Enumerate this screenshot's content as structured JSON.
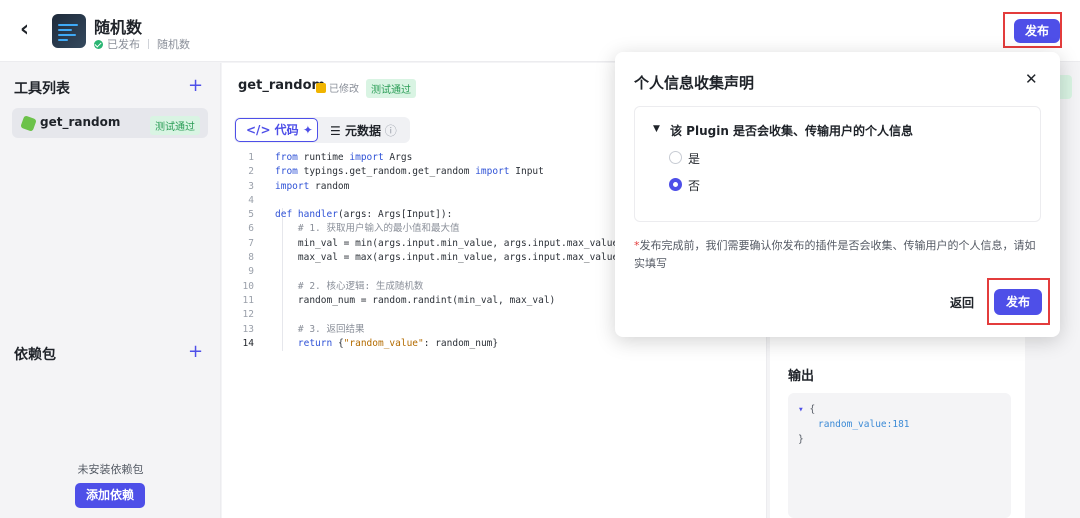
{
  "header": {
    "title": "随机数",
    "status": "已发布",
    "subtitle": "随机数",
    "publish_label": "发布"
  },
  "sidebar": {
    "tools_title": "工具列表",
    "tool_item": {
      "name": "get_random",
      "badge": "测试通过"
    },
    "deps_title": "依赖包",
    "no_deps": "未安装依赖包",
    "add_dep_label": "添加依赖"
  },
  "editor": {
    "file_title": "get_random",
    "modified": "已修改",
    "badge": "测试通过",
    "tab_code": "代码",
    "tab_meta": "元数据",
    "line_numbers": [
      "1",
      "2",
      "3",
      "4",
      "5",
      "6",
      "7",
      "8",
      "9",
      "10",
      "11",
      "12",
      "13",
      "14"
    ]
  },
  "output": {
    "title": "输出",
    "open_brace": "{",
    "entry": "random_value:181",
    "close_brace": "}"
  },
  "modal": {
    "title": "个人信息收集声明",
    "question": "该 Plugin 是否会收集、传输用户的个人信息",
    "option_yes": "是",
    "option_no": "否",
    "selected": "否",
    "note": "发布完成前，我们需要确认你发布的插件是否会收集、传输用户的个人信息，请如实填写",
    "back_label": "返回",
    "publish_label": "发布"
  },
  "colors": {
    "accent": "#4e4fe8",
    "highlight_border": "#e33c3c",
    "success": "#2a9d56"
  }
}
